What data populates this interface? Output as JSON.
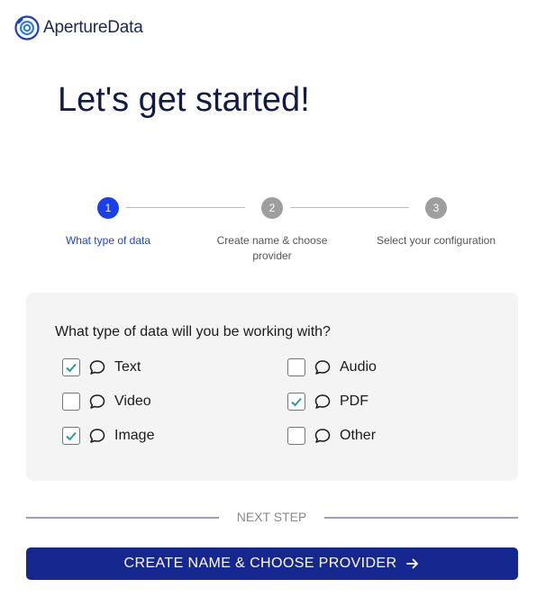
{
  "header": {
    "logo_text": "ApertureData",
    "logo_icon": "aperture-logo-icon"
  },
  "title": "Let's get started!",
  "stepper": {
    "steps": [
      {
        "number": "1",
        "label": "What type of data",
        "state": "active"
      },
      {
        "number": "2",
        "label": "Create name & choose provider",
        "state": "inactive"
      },
      {
        "number": "3",
        "label": "Select your configuration",
        "state": "inactive"
      }
    ]
  },
  "form": {
    "question": "What type of data will you be working with?",
    "options": [
      {
        "label": "Text",
        "checked": true
      },
      {
        "label": "Audio",
        "checked": false
      },
      {
        "label": "Video",
        "checked": false
      },
      {
        "label": "PDF",
        "checked": true
      },
      {
        "label": "Image",
        "checked": true
      },
      {
        "label": "Other",
        "checked": false
      }
    ]
  },
  "next_step_label": "NEXT STEP",
  "cta_label": "CREATE NAME & CHOOSE PROVIDER",
  "colors": {
    "primary": "#1a3ff0",
    "button": "#16288f",
    "check": "#2a9d8f",
    "panel": "#f4f4f4"
  }
}
